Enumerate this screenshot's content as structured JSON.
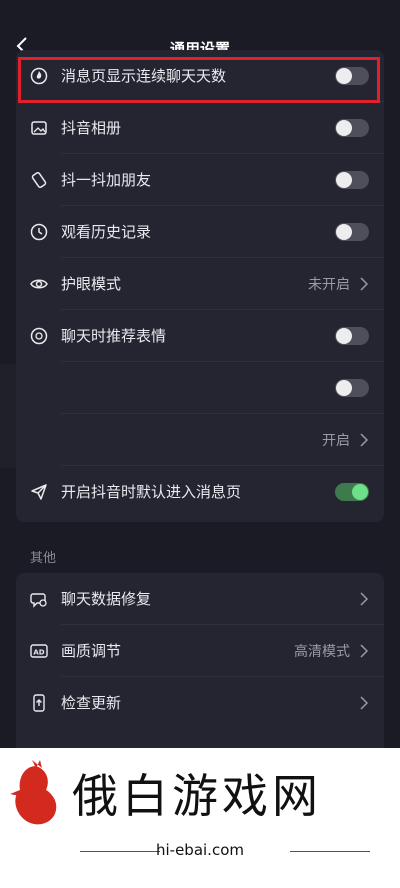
{
  "header": {
    "title": "通用设置"
  },
  "settings": [
    {
      "label": "消息页显示连续聊天天数",
      "icon": "fire-icon",
      "control": "toggle",
      "on": false
    },
    {
      "label": "抖音相册",
      "icon": "image-icon",
      "control": "toggle",
      "on": false
    },
    {
      "label": "抖一抖加朋友",
      "icon": "rotate-icon",
      "control": "toggle",
      "on": false
    },
    {
      "label": "观看历史记录",
      "icon": "clock-icon",
      "control": "toggle",
      "on": false
    },
    {
      "label": "护眼模式",
      "icon": "eye-icon",
      "control": "value",
      "value": "未开启"
    },
    {
      "label": "聊天时推荐表情",
      "icon": "emoji-icon",
      "control": "toggle",
      "on": false
    },
    {
      "label": "",
      "icon": "",
      "control": "toggle",
      "on": false
    },
    {
      "label": "",
      "icon": "",
      "control": "value",
      "value": "开启"
    },
    {
      "label": "开启抖音时默认进入消息页",
      "icon": "send-icon",
      "control": "toggle",
      "on": true
    }
  ],
  "other": {
    "title": "其他",
    "items": [
      {
        "label": "聊天数据修复",
        "icon": "chat-repair-icon",
        "control": "chevron"
      },
      {
        "label": "画质调节",
        "icon": "ad-icon",
        "control": "value",
        "value": "高清模式"
      },
      {
        "label": "检查更新",
        "icon": "update-icon",
        "control": "chevron"
      }
    ]
  },
  "watermark": {
    "text": "俄白游戏网",
    "url": "hi-ebai.com"
  },
  "colors": {
    "toggle_on": "#6fe08a",
    "highlight": "#e0202a",
    "background": "#1a1b25",
    "card": "#242531"
  }
}
